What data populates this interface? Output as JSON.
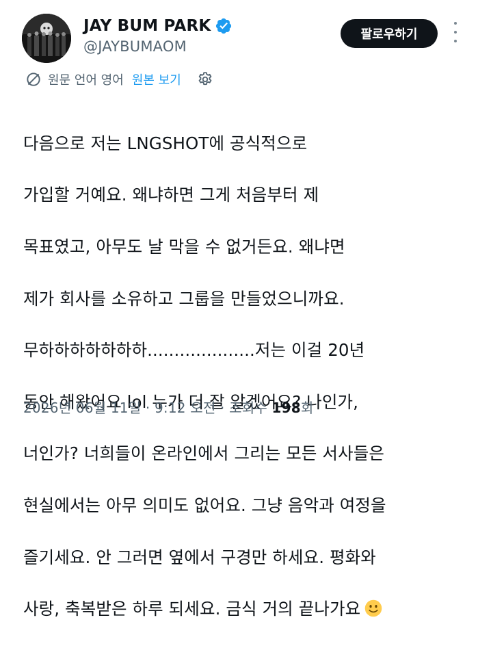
{
  "author": {
    "display_name": "JAY BUM PARK",
    "handle": "@JAYBUMAOM",
    "verified": true
  },
  "follow_button_label": "팔로우하기",
  "translation": {
    "label": "원문 언어 영어",
    "show_original_label": "원본 보기"
  },
  "tweet": {
    "lines": [
      "다음으로 저는 LNGSHOT에 공식적으로",
      "가입할 거예요. 왜냐하면 그게 처음부터 제",
      "목표였고, 아무도 날 막을 수 없거든요. 왜냐면",
      "제가 회사를 소유하고 그룹을 만들었으니까요.",
      "무하하하하하하하....................저는 이걸 20년",
      "동안 해왔어요 lol 누가 더 잘 알겠어요? 나인가,",
      "너인가? 너희들이 온라인에서 그리는 모든 서사들은",
      "현실에서는 아무 의미도 없어요. 그냥 음악과 여정을",
      "즐기세요. 안 그러면 옆에서 구경만 하세요. 평화와",
      "사랑, 축복받은 하루 되세요. 금식 거의 끝나가요"
    ],
    "trailing_emoji": "slightly-smiling-face"
  },
  "meta": {
    "date": "2026년 06월 11일",
    "separator1": " · ",
    "time": "9:12 오전",
    "separator2": " · ",
    "views_label": "조회수 ",
    "views_count": "198",
    "views_suffix": "회"
  },
  "colors": {
    "text": "#0f1419",
    "secondary": "#536471",
    "link": "#1d9bf0",
    "verified": "#1d9bf0",
    "button_bg": "#0f1419",
    "emoji": "#ffcc4d"
  },
  "icons": [
    "avatar",
    "verified-badge-icon",
    "more-options-icon",
    "translate-icon",
    "gear-icon",
    "smile-emoji-icon"
  ]
}
